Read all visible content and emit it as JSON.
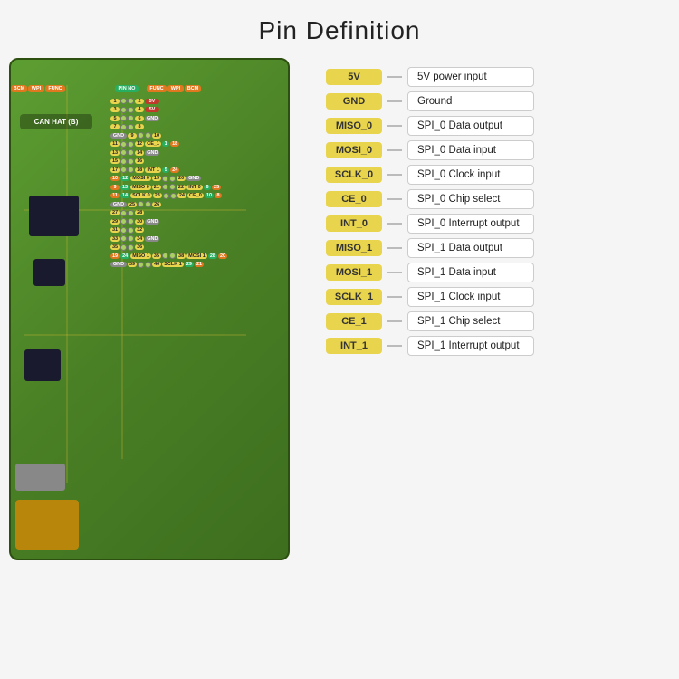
{
  "title": "Pin Definition",
  "legend": [
    {
      "badge": "5V",
      "desc": "5V power input"
    },
    {
      "badge": "GND",
      "desc": "Ground"
    },
    {
      "badge": "MISO_0",
      "desc": "SPI_0 Data output"
    },
    {
      "badge": "MOSI_0",
      "desc": "SPI_0 Data input"
    },
    {
      "badge": "SCLK_0",
      "desc": "SPI_0 Clock input"
    },
    {
      "badge": "CE_0",
      "desc": "SPI_0 Chip select"
    },
    {
      "badge": "INT_0",
      "desc": "SPI_0 Interrupt output"
    },
    {
      "badge": "MISO_1",
      "desc": "SPI_1 Data output"
    },
    {
      "badge": "MOSI_1",
      "desc": "SPI_1 Data input"
    },
    {
      "badge": "SCLK_1",
      "desc": "SPI_1 Clock input"
    },
    {
      "badge": "CE_1",
      "desc": "SPI_1 Chip select"
    },
    {
      "badge": "INT_1",
      "desc": "SPI_1 Interrupt output"
    }
  ],
  "board_header": {
    "cols": [
      "BCM",
      "WPI",
      "FUNC",
      "PIN NO",
      "FUNC",
      "WPI",
      "BCM"
    ]
  },
  "pin_rows": [
    {
      "left": [],
      "pin_l": "1",
      "pin_r": "2",
      "right_func": "5V"
    },
    {
      "left": [],
      "pin_l": "3",
      "pin_r": "4",
      "right_func": "5V"
    },
    {
      "left": [],
      "pin_l": "5",
      "pin_r": "6",
      "right_func": "GND"
    },
    {
      "left": [],
      "pin_l": "7",
      "pin_r": "8",
      "right_func": ""
    },
    {
      "left": [
        "GND"
      ],
      "pin_l": "9",
      "pin_r": "10",
      "right_func": ""
    },
    {
      "left": [],
      "pin_l": "11",
      "pin_r": "12",
      "right_func": "CE_1"
    },
    {
      "left": [],
      "pin_l": "13",
      "pin_r": "14",
      "right_func": "GND"
    },
    {
      "left": [],
      "pin_l": "15",
      "pin_r": "16",
      "right_func": ""
    },
    {
      "left": [],
      "pin_l": "17",
      "pin_r": "18",
      "right_func": "INT 1"
    },
    {
      "left": [
        "12",
        "MOSI 0",
        "10"
      ],
      "pin_l": "19",
      "pin_r": "20",
      "right_func": "GND"
    },
    {
      "left": [
        "13",
        "MISO 0",
        "21"
      ],
      "pin_l": "21",
      "pin_r": "22",
      "right_func": "INT 0"
    },
    {
      "left": [
        "11",
        "SCLK 0",
        "23"
      ],
      "pin_l": "23",
      "pin_r": "24",
      "right_func": "CE_0"
    },
    {
      "left": [
        "GND"
      ],
      "pin_l": "25",
      "pin_r": "26",
      "right_func": ""
    },
    {
      "left": [],
      "pin_l": "27",
      "pin_r": "28",
      "right_func": ""
    },
    {
      "left": [],
      "pin_l": "29",
      "pin_r": "30",
      "right_func": "GND"
    },
    {
      "left": [],
      "pin_l": "31",
      "pin_r": "32",
      "right_func": ""
    },
    {
      "left": [],
      "pin_l": "33",
      "pin_r": "34",
      "right_func": "GND"
    },
    {
      "left": [],
      "pin_l": "35",
      "pin_r": "36",
      "right_func": ""
    },
    {
      "left": [
        "19",
        "24",
        "MISO 1",
        "35"
      ],
      "pin_l": "35",
      "pin_r": "38",
      "right_func": "MOSI 1"
    },
    {
      "left": [
        "GND"
      ],
      "pin_l": "39",
      "pin_r": "40",
      "right_func": "SCLK 1"
    }
  ],
  "colors": {
    "yellow": "#e8d44d",
    "orange": "#e07820",
    "red": "#c0392b",
    "green": "#27ae60",
    "gray": "#888888",
    "board_bg": "#4a8025"
  }
}
